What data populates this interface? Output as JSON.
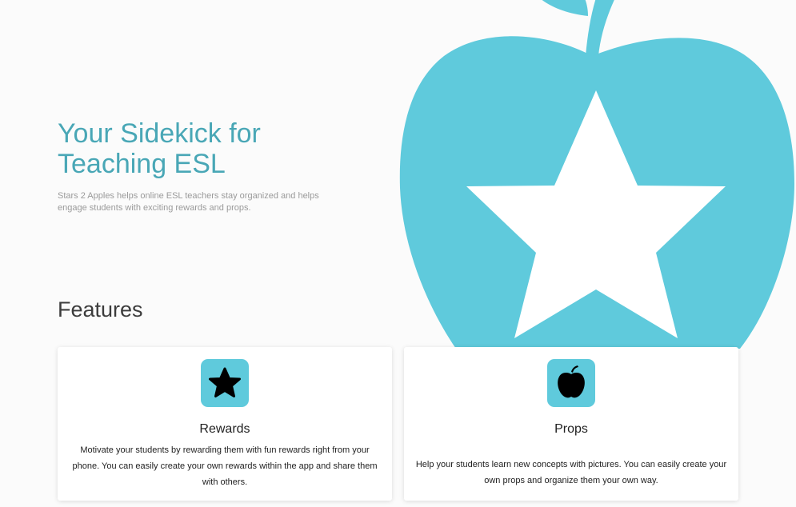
{
  "hero": {
    "title": "Your Sidekick for Teaching ESL",
    "subtitle": "Stars 2 Apples helps online ESL teachers stay organized and helps engage students with exciting rewards and props."
  },
  "features": {
    "heading": "Features",
    "cards": [
      {
        "icon": "star-icon",
        "title": "Rewards",
        "text": "Motivate your students by rewarding them with fun rewards right from your phone. You can easily create your own rewards within the app and share them with others."
      },
      {
        "icon": "apple-icon",
        "title": "Props",
        "text": "Help your students learn new concepts with pictures. You can easily create your own props and organize them your own way."
      }
    ]
  },
  "colors": {
    "accent": "#5fcadc",
    "title": "#49a7b6",
    "background": "#fbfbfb"
  }
}
